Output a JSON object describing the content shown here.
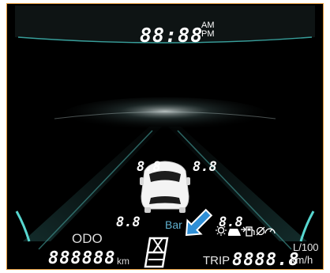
{
  "clock": {
    "time": "88:88",
    "am": "AM",
    "pm": "PM"
  },
  "tire_pressure": {
    "front_left": "8.8",
    "front_right": "8.8",
    "rear_left": "8.8",
    "rear_right": "8.8",
    "unit": "Bar"
  },
  "odometer": {
    "label": "ODO",
    "value": "888888",
    "unit": "km"
  },
  "trip": {
    "label": "TRIP",
    "value": "8888.8",
    "unit_top": "L/100",
    "unit_bottom": "km/h"
  },
  "status_icons": [
    "sun-icon",
    "car-icon",
    "fuel-pump-icon",
    "empty-set-icon",
    "gauge-icon"
  ],
  "colors": {
    "background": "#000000",
    "accent_teal": "#3fb7b3",
    "highlight_blue": "#2f8fd6",
    "unit_blue": "#5fb0cf",
    "frame_border": "#e39a3a"
  }
}
